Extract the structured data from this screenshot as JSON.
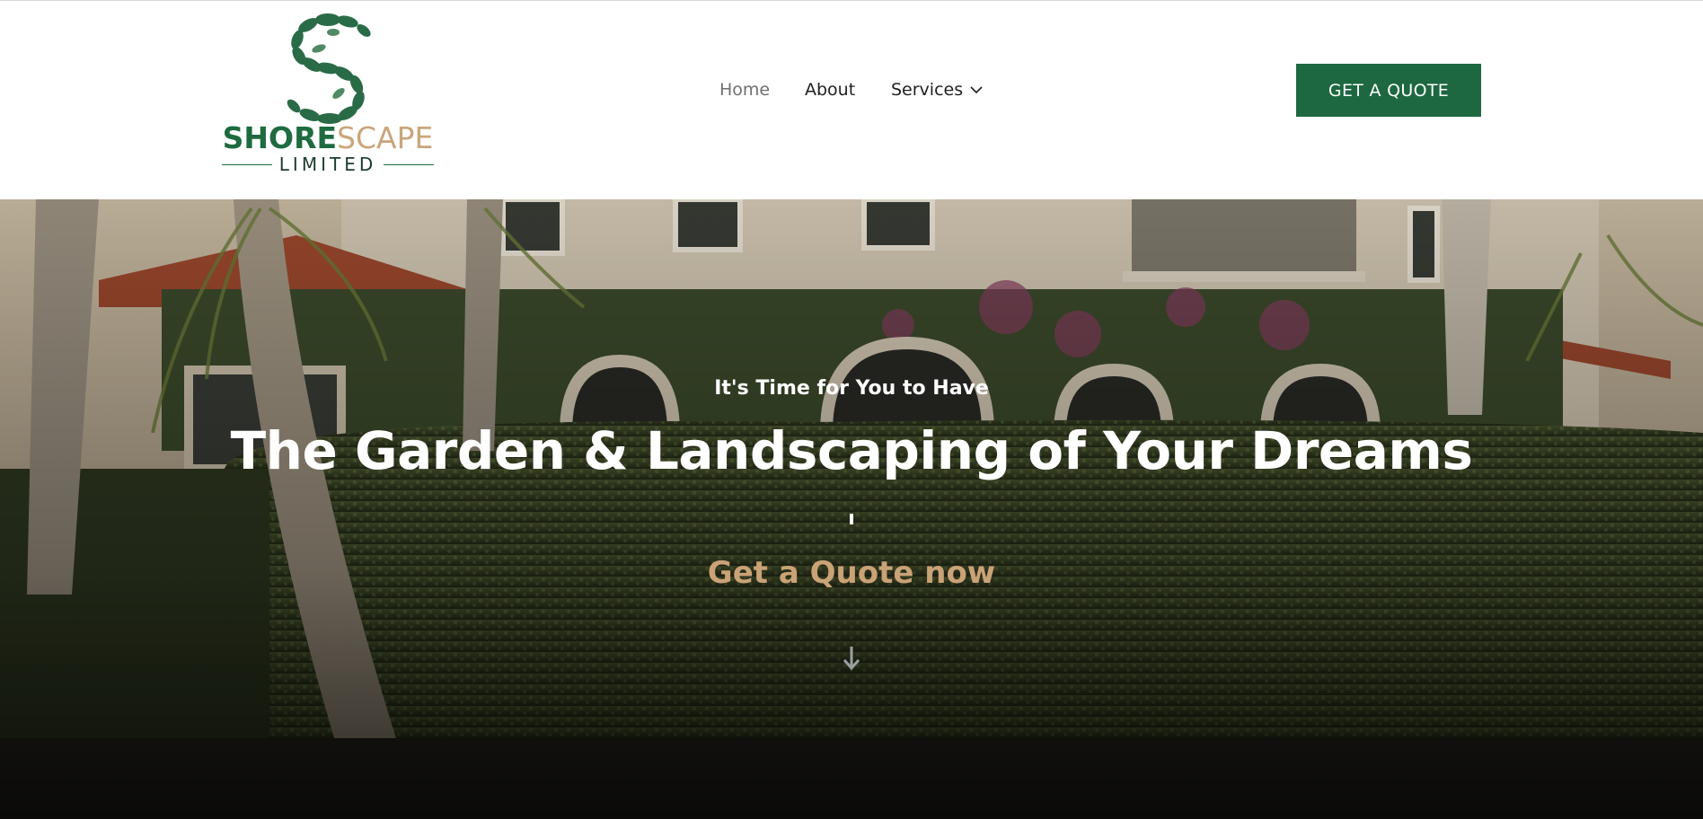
{
  "header": {
    "logo": {
      "brand_part1": "SHORE",
      "brand_part2": "SCAPE",
      "subline": "LIMITED",
      "colors": {
        "green": "#1e6b40",
        "tan": "#caa57b"
      }
    },
    "nav": [
      {
        "label": "Home",
        "active": true
      },
      {
        "label": "About",
        "active": false
      },
      {
        "label": "Services",
        "active": false,
        "icon": "chevron-down-icon"
      }
    ],
    "cta_label": "GET A QUOTE",
    "cta_color": "#1d6840"
  },
  "hero": {
    "eyebrow": "It's Time for You to Have",
    "title": "The Garden & Landscaping of Your Dreams",
    "cta": "Get a Quote now",
    "cta_color": "#c9a276",
    "scroll_icon": "arrow-down-icon"
  }
}
